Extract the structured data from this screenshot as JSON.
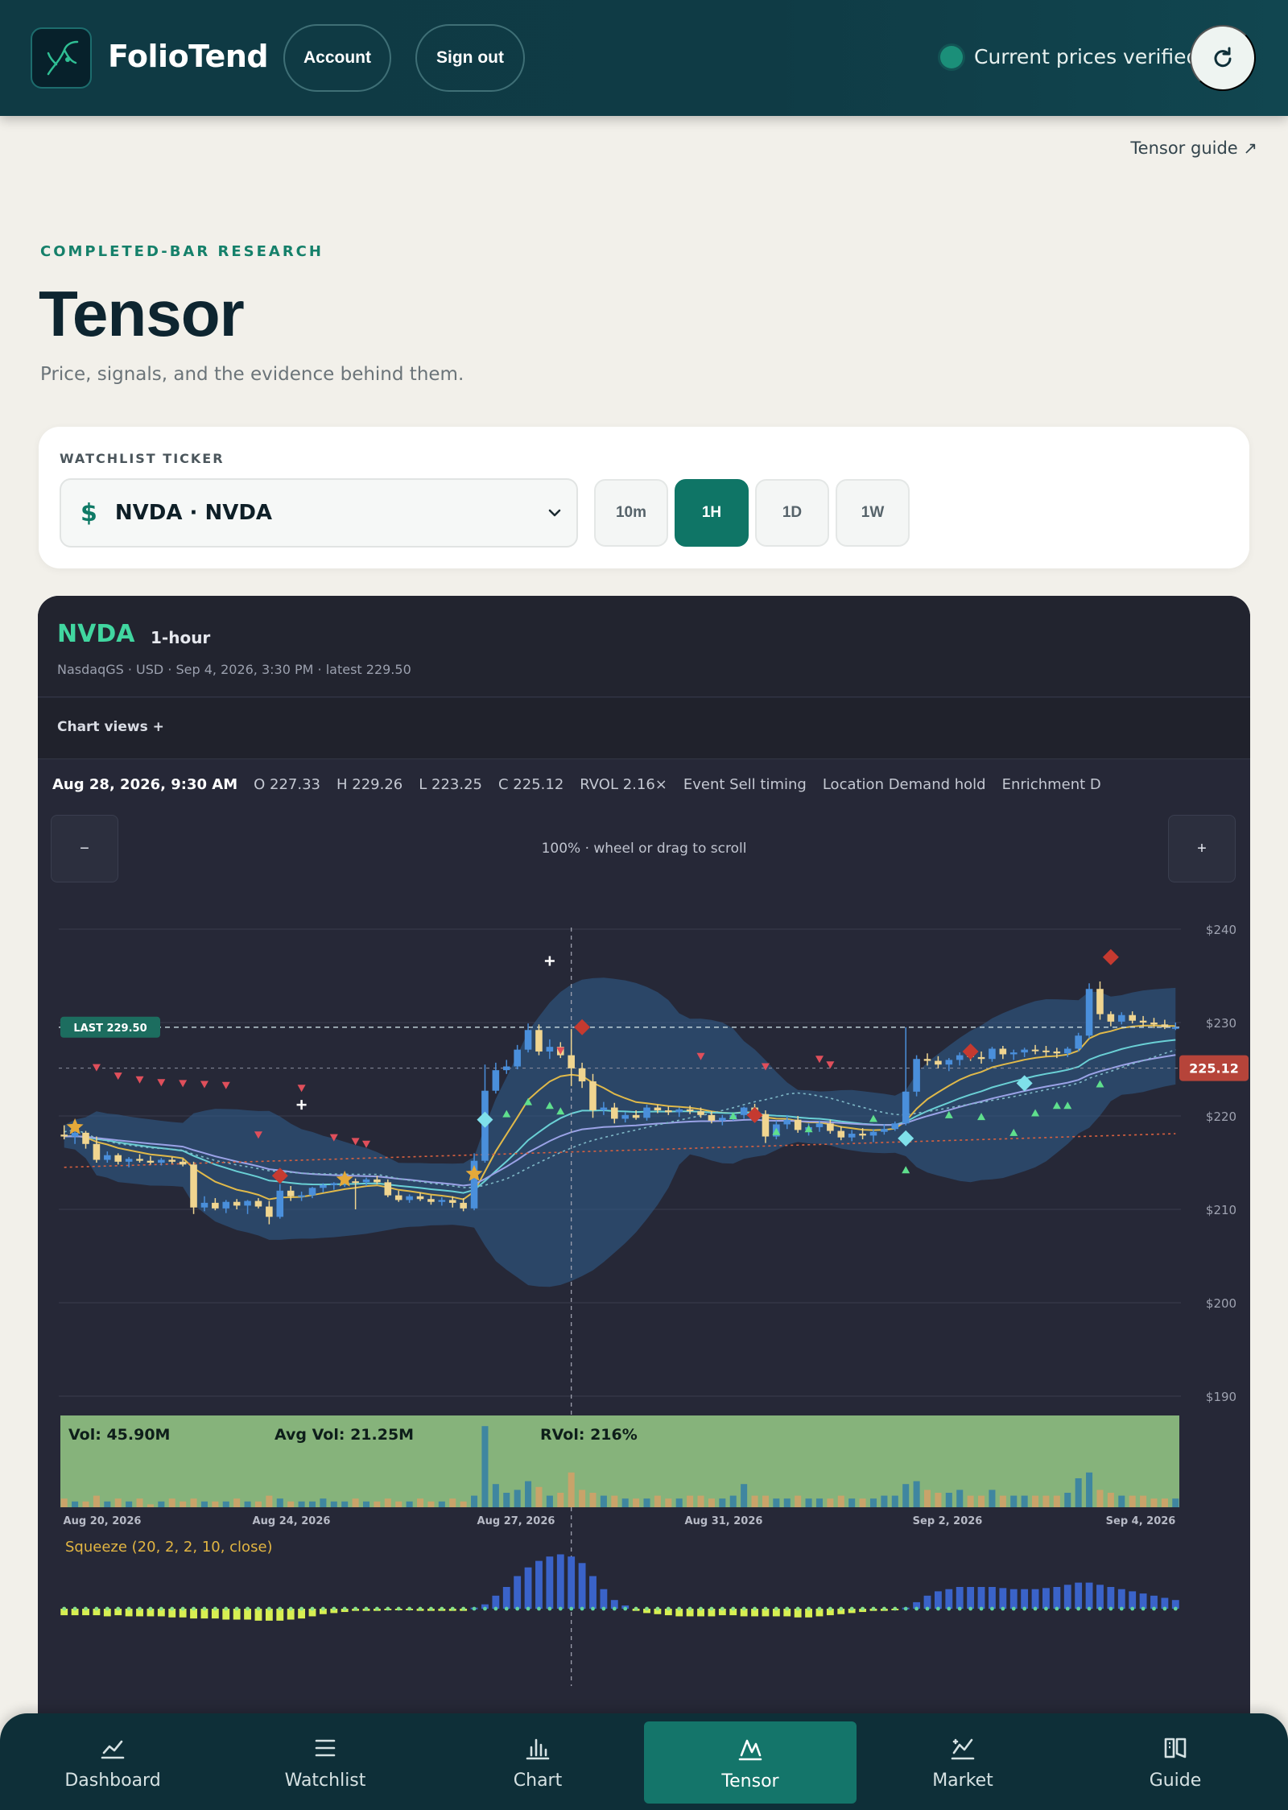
{
  "header": {
    "brand": "FolioTend",
    "account_label": "Account",
    "signout_label": "Sign out",
    "status_text": "Current prices verified",
    "status_color": "#1b8f79"
  },
  "guide_link": "Tensor guide ↗",
  "page": {
    "eyebrow": "COMPLETED-BAR RESEARCH",
    "title": "Tensor",
    "subtitle": "Price, signals, and the evidence behind them."
  },
  "ticker_card": {
    "label": "WATCHLIST TICKER",
    "selected": "NVDA · NVDA",
    "timeframes": [
      "10m",
      "1H",
      "1D",
      "1W"
    ],
    "active_timeframe": "1H"
  },
  "chart_panel": {
    "ticker": "NVDA",
    "interval": "1-hour",
    "meta": "NasdaqGS · USD · Sep 4, 2026, 3:30 PM · latest 229.50",
    "views_label": "Chart views +",
    "ohlc": {
      "date": "Aug 28, 2026, 9:30 AM",
      "open": "O 227.33",
      "high": "H 229.26",
      "low": "L 223.25",
      "close": "C 225.12",
      "rvol": "RVOL 2.16×",
      "event": "Event Sell timing",
      "location": "Location Demand hold",
      "enrichment": "Enrichment D"
    },
    "zoom_out_label": "−",
    "zoom_in_label": "+",
    "zoom_text": "100% · wheel or drag to scroll"
  },
  "chart_data": {
    "type": "candlestick",
    "y_ticks": [
      "$240",
      "$230",
      "$220",
      "$210",
      "$200",
      "$190"
    ],
    "ylim": [
      190,
      240
    ],
    "last_label": "LAST 229.50",
    "last_value": 229.5,
    "crosshair_label": "225.12",
    "crosshair_value": 225.12,
    "x_ticks": [
      "Aug 20, 2026",
      "Aug 24, 2026",
      "Aug 27, 2026",
      "Aug 31, 2026",
      "Sep 2, 2026",
      "Sep 4, 2026"
    ],
    "candles": [
      [
        218,
        219,
        217.5,
        217.8
      ],
      [
        217.8,
        218.5,
        217,
        218.2
      ],
      [
        218.2,
        218.4,
        216.5,
        217
      ],
      [
        217,
        217.8,
        215,
        215.3
      ],
      [
        215.3,
        216.2,
        215,
        215.8
      ],
      [
        215.8,
        216,
        214.8,
        215.1
      ],
      [
        215.1,
        215.6,
        214.5,
        215.4
      ],
      [
        215.4,
        215.9,
        215,
        215.2
      ],
      [
        215.2,
        215.7,
        214.8,
        215
      ],
      [
        215,
        215.5,
        214.7,
        215.3
      ],
      [
        215.3,
        215.6,
        214.9,
        215.1
      ],
      [
        215.1,
        215.4,
        214.6,
        214.8
      ],
      [
        214.8,
        215.1,
        209.5,
        210.2
      ],
      [
        210.2,
        211.4,
        209.8,
        210.7
      ],
      [
        210.7,
        211.2,
        209.9,
        210.1
      ],
      [
        210.1,
        211,
        209.6,
        210.8
      ],
      [
        210.8,
        211.1,
        210,
        210.4
      ],
      [
        210.4,
        211,
        209.5,
        210.9
      ],
      [
        210.9,
        211.2,
        210.1,
        210.3
      ],
      [
        210.3,
        210.9,
        208.4,
        209.2
      ],
      [
        209.2,
        212.7,
        209,
        212
      ],
      [
        212,
        212.5,
        210.9,
        211.4
      ],
      [
        211.4,
        211.9,
        210.9,
        211.5
      ],
      [
        211.5,
        212.4,
        211.2,
        212.3
      ],
      [
        212.3,
        212.8,
        211.8,
        212.6
      ],
      [
        212.6,
        212.9,
        212.1,
        212.8
      ],
      [
        212.8,
        213.2,
        212.4,
        213
      ],
      [
        213,
        213.3,
        210,
        212.9
      ],
      [
        212.9,
        213.4,
        212.5,
        213.2
      ],
      [
        213.2,
        213.6,
        212.7,
        212.9
      ],
      [
        212.9,
        213.2,
        211.3,
        211.5
      ],
      [
        211.5,
        212,
        210.8,
        211
      ],
      [
        211,
        211.6,
        210.7,
        211.4
      ],
      [
        211.4,
        211.8,
        210.9,
        211.1
      ],
      [
        211.1,
        211.5,
        210.5,
        210.8
      ],
      [
        210.8,
        211.3,
        210.4,
        211
      ],
      [
        211,
        211.4,
        210.2,
        210.7
      ],
      [
        210.7,
        211.2,
        209.8,
        210.1
      ],
      [
        210.1,
        216,
        209.9,
        215.2
      ],
      [
        215.2,
        225.5,
        215,
        222.7
      ],
      [
        222.7,
        225.7,
        222.4,
        224.9
      ],
      [
        224.9,
        226,
        224.5,
        225.3
      ],
      [
        225.3,
        227.6,
        225,
        227.1
      ],
      [
        227.1,
        229.9,
        226.8,
        229.2
      ],
      [
        229.2,
        229.8,
        226.5,
        226.9
      ],
      [
        226.9,
        228.2,
        226.1,
        227.4
      ],
      [
        227.4,
        227.9,
        226.2,
        226.5
      ],
      [
        226.5,
        229.3,
        223.2,
        225.1
      ],
      [
        225.1,
        225.7,
        223,
        223.7
      ],
      [
        223.7,
        224.5,
        219.8,
        220.6
      ],
      [
        220.6,
        221.5,
        220.1,
        220.9
      ],
      [
        220.9,
        221.4,
        219.2,
        219.7
      ],
      [
        219.7,
        220.4,
        219.3,
        220.1
      ],
      [
        220.1,
        220.6,
        219.6,
        219.8
      ],
      [
        219.8,
        221.2,
        219.5,
        220.9
      ],
      [
        220.9,
        221.2,
        220.3,
        220.6
      ],
      [
        220.6,
        221,
        220.1,
        220.4
      ],
      [
        220.4,
        220.9,
        219.9,
        220.7
      ],
      [
        220.7,
        221.1,
        220.2,
        220.5
      ],
      [
        220.5,
        220.9,
        219.8,
        220.1
      ],
      [
        220.1,
        220.5,
        219.2,
        219.5
      ],
      [
        219.5,
        220.1,
        219,
        219.8
      ],
      [
        219.8,
        220.3,
        219.5,
        220.1
      ],
      [
        220.1,
        221,
        219.7,
        220.9
      ],
      [
        220.9,
        221.3,
        219.9,
        220.2
      ],
      [
        220.2,
        220.6,
        217.1,
        217.8
      ],
      [
        217.8,
        219.5,
        217.5,
        219.1
      ],
      [
        219.1,
        220.1,
        218.6,
        219.6
      ],
      [
        219.6,
        220,
        218.2,
        218.5
      ],
      [
        218.5,
        219.2,
        217.9,
        218.8
      ],
      [
        218.8,
        219.5,
        218.3,
        219.2
      ],
      [
        219.2,
        219.6,
        218.1,
        218.4
      ],
      [
        218.4,
        218.9,
        217.4,
        217.7
      ],
      [
        217.7,
        218.5,
        217.3,
        218.1
      ],
      [
        218.1,
        218.7,
        217.5,
        217.9
      ],
      [
        217.9,
        218.6,
        217.2,
        218.3
      ],
      [
        218.3,
        219.1,
        218,
        218.6
      ],
      [
        218.6,
        219.4,
        218.4,
        219.2
      ],
      [
        219.2,
        229.5,
        219,
        222.6
      ],
      [
        222.6,
        226.5,
        222.1,
        226.1
      ],
      [
        226.1,
        226.7,
        225.4,
        225.9
      ],
      [
        225.9,
        226.4,
        225.1,
        225.5
      ],
      [
        225.5,
        226.2,
        224.8,
        226
      ],
      [
        226,
        226.8,
        225.4,
        226.5
      ],
      [
        226.5,
        227.1,
        225.9,
        226.3
      ],
      [
        226.3,
        226.9,
        225.6,
        226.1
      ],
      [
        226.1,
        227.4,
        225.8,
        227.2
      ],
      [
        227.2,
        227.5,
        226.1,
        226.6
      ],
      [
        226.6,
        227.1,
        226,
        226.8
      ],
      [
        226.8,
        227.3,
        226.3,
        227.1
      ],
      [
        227.1,
        227.6,
        226.6,
        227
      ],
      [
        227,
        227.5,
        226.4,
        226.9
      ],
      [
        226.9,
        227.3,
        226.2,
        226.7
      ],
      [
        226.7,
        227.4,
        226.3,
        227.2
      ],
      [
        227.2,
        228.9,
        226.9,
        228.6
      ],
      [
        228.6,
        234.2,
        228.3,
        233.6
      ],
      [
        233.6,
        234.4,
        230.3,
        230.9
      ],
      [
        230.9,
        231.2,
        229.6,
        230.1
      ],
      [
        230.1,
        231.1,
        229.8,
        230.8
      ],
      [
        230.8,
        231.2,
        229.9,
        230.2
      ],
      [
        230.2,
        230.7,
        229.6,
        230
      ],
      [
        230,
        230.5,
        229.4,
        229.8
      ],
      [
        229.8,
        230.3,
        229.3,
        229.5
      ],
      [
        229.5,
        230,
        229.2,
        229.5
      ]
    ],
    "volume_label": "Vol: 45.90M",
    "avg_volume_label": "Avg Vol: 21.25M",
    "rvol_label": "RVol: 216%",
    "squeeze_label": "Squeeze (20, 2, 2, 10, close)",
    "colors": {
      "bull": "#4a8fdb",
      "bear": "#f0d590",
      "volume_bg": "#86b37b",
      "squeeze_pos": "#3a63c9",
      "squeeze_neg": "#d8ef52",
      "last_badge": "#1c6d5f",
      "crosshair_badge": "#b6443a"
    }
  },
  "bottom_nav": {
    "items": [
      "Dashboard",
      "Watchlist",
      "Chart",
      "Tensor",
      "Market",
      "Guide"
    ],
    "active": "Tensor"
  }
}
